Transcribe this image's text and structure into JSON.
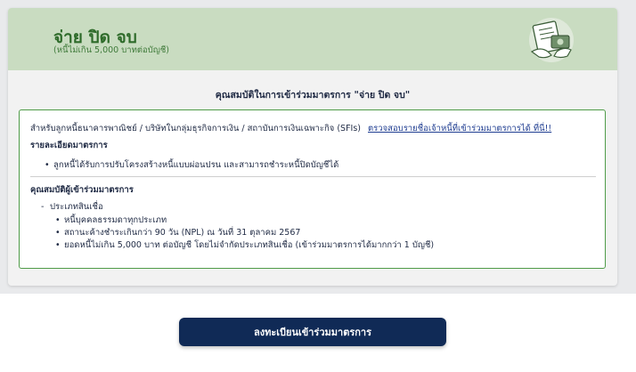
{
  "header": {
    "title": "จ่าย ปิด จบ",
    "subtitle": "(หนี้ไม่เกิน 5,000 บาทต่อบัญชี)",
    "illustration_icon": "document-handshake-icon"
  },
  "section": {
    "heading": "คุณสมบัติในการเข้าร่วมมาตรการ \"จ่าย ปิด จบ\""
  },
  "info": {
    "eligible_text": "สำหรับลูกหนี้ธนาคารพาณิชย์ / บริษัทในกลุ่มธุรกิจการเงิน / สถาบันการเงินเฉพาะกิจ (SFIs)",
    "eligible_link": "ตรวจสอบรายชื่อเจ้าหนี้ที่เข้าร่วมมาตรการได้ ที่นี่!!",
    "details_heading": "รายละเอียดมาตรการ",
    "details_items": [
      "ลูกหนี้ได้รับการปรับโครงสร้างหนี้แบบผ่อนปรน และสามารถชำระหนี้ปิดบัญชีได้"
    ],
    "qualifications_heading": "คุณสมบัติผู้เข้าร่วมมาตรการ",
    "credit_type_label": "ประเภทสินเชื่อ",
    "qualification_items": [
      "หนี้บุคคลธรรมดาทุกประเภท",
      "สถานะค้างชำระเกินกว่า 90 วัน (NPL) ณ วันที่ 31 ตุลาคม 2567",
      "ยอดหนี้ไม่เกิน 5,000 บาท ต่อบัญชี โดยไม่จำกัดประเภทสินเชื่อ (เข้าร่วมมาตรการได้มากกว่า 1 บัญชี)"
    ]
  },
  "footer": {
    "register_button": "ลงทะเบียนเข้าร่วมมาตรการ"
  },
  "colors": {
    "header_bg": "#c9dcc1",
    "title_green": "#2e6b2a",
    "box_border": "#4f9b48",
    "button_bg": "#102a56",
    "link_blue": "#1f3d91"
  }
}
